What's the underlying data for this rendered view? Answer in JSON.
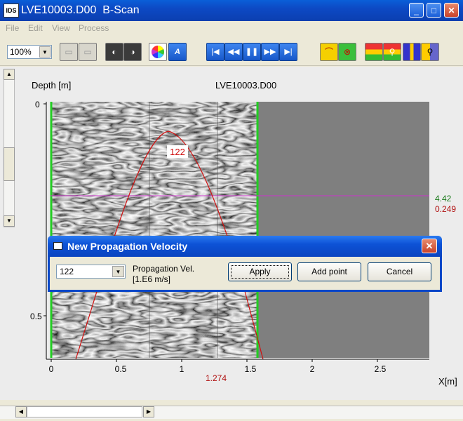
{
  "window": {
    "app_icon_text": "IDS",
    "title": "LVE10003.D00  B-Scan",
    "minimize_glyph": "_",
    "maximize_glyph": "□",
    "close_glyph": "✕"
  },
  "menu": {
    "items": [
      "File",
      "Edit",
      "View",
      "Process"
    ]
  },
  "toolbar": {
    "zoom": "100%",
    "icons": [
      "copy-icon",
      "save-icon",
      "wave-left-icon",
      "wave-right-icon",
      "color-wheel-icon",
      "text-icon",
      "first-icon",
      "rewind-icon",
      "pause-icon",
      "forward-icon",
      "last-icon",
      "hyperbola-icon",
      "delete-icon",
      "layers-icon",
      "zoom-layer-icon",
      "bar-icon",
      "probe-icon"
    ]
  },
  "plot": {
    "file_label": "LVE10003.D00",
    "depth_label": "Depth [m]",
    "x_label": "X[m]",
    "y_ticks": [
      "0",
      "0.5"
    ],
    "x_ticks": [
      "0",
      "0.5",
      "1",
      "1.5",
      "2",
      "2.5"
    ],
    "hyperbola_velocity": "122",
    "cursor_x_value": "1.274",
    "cursor_readout_top": "4.42",
    "cursor_readout_bottom": "0.249",
    "colors": {
      "hyperbola": "#d01010",
      "marker": "#22cc22",
      "cursor_line": "#cc33cc",
      "readout_green": "#1a7a1a",
      "readout_red": "#b01010"
    }
  },
  "dialog": {
    "title": "New Propagation Velocity",
    "close_glyph": "✕",
    "velocity_value": "122",
    "label_line1": "Propagation Vel.",
    "label_line2": "[1.E6 m/s]",
    "apply": "Apply",
    "add_point": "Add point",
    "cancel": "Cancel"
  }
}
